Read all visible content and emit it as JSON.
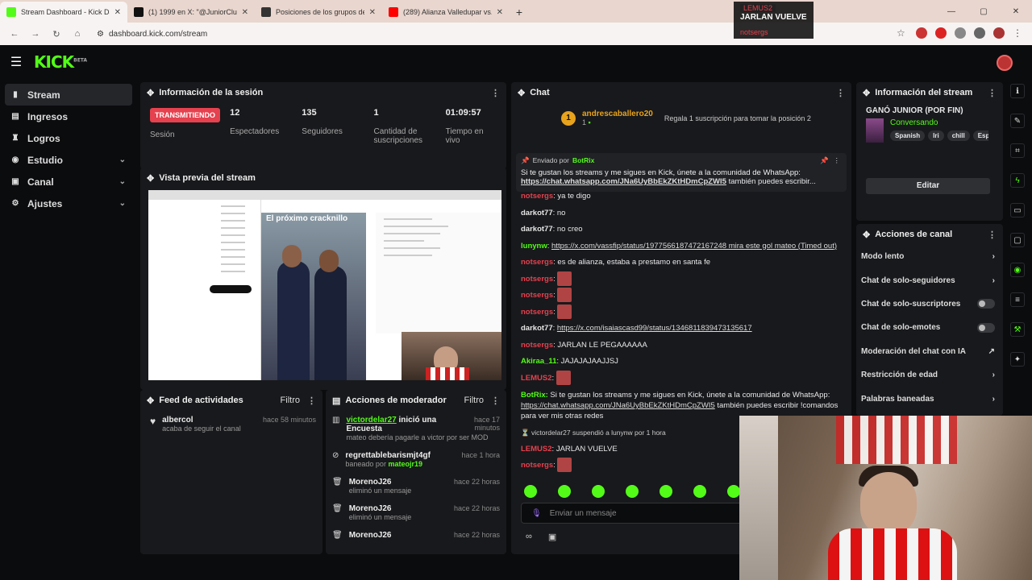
{
  "browser": {
    "tabs": [
      {
        "title": "Stream Dashboard - Kick Dashboard",
        "color": "#53fc18"
      },
      {
        "title": "(1) 1999 en X: \"@JuniorClubSA\"",
        "color": "#111111"
      },
      {
        "title": "Posiciones de los grupos de Lig",
        "color": "#333333"
      },
      {
        "title": "(289) Alianza Valledupar vs. Jun",
        "color": "#ff0000"
      }
    ],
    "url": "dashboard.kick.com/stream"
  },
  "overlay": {
    "user": "LEMUS2",
    "text": "JARLAN VUELVE",
    "user2": "notsergs"
  },
  "sidebar": {
    "items": [
      {
        "label": "Stream",
        "icon": "stream-icon"
      },
      {
        "label": "Ingresos",
        "icon": "dollar-icon"
      },
      {
        "label": "Logros",
        "icon": "trophy-icon"
      },
      {
        "label": "Estudio",
        "icon": "studio-icon"
      },
      {
        "label": "Canal",
        "icon": "channel-icon"
      },
      {
        "label": "Ajustes",
        "icon": "gear-icon"
      }
    ]
  },
  "session": {
    "title": "Información de la sesión",
    "status": "TRANSMITIENDO",
    "status_label": "Sesión",
    "stats": [
      {
        "value": "12",
        "label": "Espectadores"
      },
      {
        "value": "135",
        "label": "Seguidores"
      },
      {
        "value": "1",
        "label": "Cantidad de suscripciones"
      },
      {
        "value": "01:09:57",
        "label": "Tiempo en vivo"
      }
    ]
  },
  "preview": {
    "title": "Vista previa del stream",
    "post_title": "El próximo cracknillo"
  },
  "activity": {
    "title": "Feed de actividades",
    "filter": "Filtro",
    "items": [
      {
        "user": "albercol",
        "action": "acaba de seguir el canal",
        "time": "hace 58 minutos"
      }
    ]
  },
  "modactions": {
    "title": "Acciones de moderador",
    "filter": "Filtro",
    "items": [
      {
        "user": "victordelar27",
        "action": "inició una Encuesta",
        "detail": "mateo debería pagarle a victor por ser MOD",
        "time": "hace 17 minutos"
      },
      {
        "user": "regrettablebarismjt4gf",
        "action": "baneado por",
        "by": "mateojr19",
        "time": "hace 1 hora"
      },
      {
        "user": "MorenoJ26",
        "action": "eliminó un mensaje",
        "time": "hace 22 horas"
      },
      {
        "user": "MorenoJ26",
        "action": "eliminó un mensaje",
        "time": "hace 22 horas"
      },
      {
        "user": "MorenoJ26",
        "action": "",
        "time": "hace 22 horas"
      }
    ]
  },
  "chat": {
    "title": "Chat",
    "gift_user": "andrescaballero20",
    "gift_count": "1",
    "gift_text": "Regala 1 suscripción para tomar la posición 2",
    "pinned_by": "Enviado por",
    "pinned_user": "BotRix",
    "pinned_text": "Si te gustan los streams y me sigues en Kick, únete a la comunidad de WhatsApp:",
    "pinned_link": "https://chat.whatsapp.com/JNa6UyBbEkZKtHDmCpZWI5",
    "pinned_tail": "también puedes escribir...",
    "messages": [
      {
        "user": "notsergs",
        "cls": "u-red",
        "text": "ya te digo"
      },
      {
        "user": "darkot77",
        "cls": "u-white",
        "text": "no"
      },
      {
        "user": "darkot77",
        "cls": "u-white",
        "text": "no creo"
      },
      {
        "user": "lunynw",
        "cls": "u-green",
        "text": "https://x.com/vassfip/status/1977566187472167248 mira este gol mateo (Timed out)"
      },
      {
        "user": "notsergs",
        "cls": "u-red",
        "text": "es de alianza, estaba a prestamo en santa fe"
      },
      {
        "user": "notsergs",
        "cls": "u-red",
        "text": "",
        "emote": true
      },
      {
        "user": "notsergs",
        "cls": "u-red",
        "text": "",
        "emote": true
      },
      {
        "user": "notsergs",
        "cls": "u-red",
        "text": "",
        "emote": true
      },
      {
        "user": "darkot77",
        "cls": "u-white",
        "text": "https://x.com/isaiascasd99/status/1346811839473135617"
      },
      {
        "user": "notsergs",
        "cls": "u-red",
        "text": "JARLAN LE PEGAAAAAA"
      },
      {
        "user": "Akiraa_11",
        "cls": "u-green",
        "text": "JAJAJAJAAJJSJ"
      },
      {
        "user": "LEMUS2",
        "cls": "u-red",
        "text": "",
        "emote": true
      }
    ],
    "bot_user": "BotRix",
    "bot_text": "Si te gustan los streams y me sigues en Kick, únete a la comunidad de WhatsApp:",
    "bot_link": "https://chat.whatsapp.com/JNa6UyBbEkZKtHDmCpZWI5",
    "bot_tail": "también puedes escribir !comandos",
    "bot_tail2": "para ver mis otras redes",
    "suspend": "victordelar27 suspendió a lunynw por 1 hora",
    "after": [
      {
        "user": "LEMUS2",
        "cls": "u-red",
        "text": "JARLAN VUELVE"
      },
      {
        "user": "notsergs",
        "cls": "u-red",
        "text": "",
        "emote": true
      }
    ],
    "input_placeholder": "Enviar un mensaje"
  },
  "streaminfo": {
    "title": "Información del stream",
    "stream_title": "GANÓ JUNIOR (POR FIN)",
    "category": "Conversando",
    "tags": [
      "Spanish",
      "lri",
      "chill",
      "Espa"
    ],
    "edit": "Editar"
  },
  "channelactions": {
    "title": "Acciones de canal",
    "items": [
      {
        "label": "Modo lento",
        "kind": "chevron"
      },
      {
        "label": "Chat de solo-seguidores",
        "kind": "chevron"
      },
      {
        "label": "Chat de solo-suscriptores",
        "kind": "toggle"
      },
      {
        "label": "Chat de solo-emotes",
        "kind": "toggle"
      },
      {
        "label": "Moderación del chat con IA",
        "kind": "link"
      },
      {
        "label": "Restricción de edad",
        "kind": "chevron"
      },
      {
        "label": "Palabras baneadas",
        "kind": "chevron"
      }
    ]
  }
}
